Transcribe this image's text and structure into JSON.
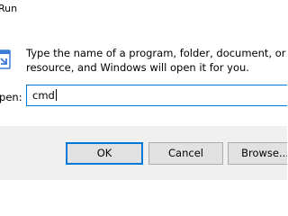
{
  "window": {
    "title": "Run"
  },
  "description": {
    "line1": "Type the name of a program, folder, document, or Internet",
    "line2": "resource, and Windows will open it for you."
  },
  "open": {
    "label": "Open:",
    "value": "cmd"
  },
  "buttons": {
    "ok": "OK",
    "cancel": "Cancel",
    "browse": "Browse..."
  },
  "icons": {
    "run": "run-program-icon"
  },
  "colors": {
    "accent": "#0078d7",
    "footer_bg": "#f0f0f0",
    "button_bg": "#e1e1e1"
  }
}
